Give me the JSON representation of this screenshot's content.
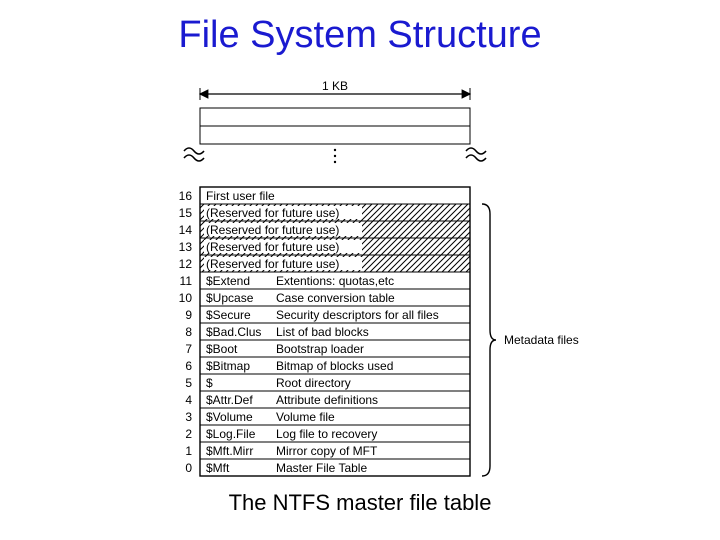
{
  "title": "File System Structure",
  "caption": "The NTFS master file table",
  "size_label": "1 KB",
  "brace_label": "Metadata files",
  "chart_data": {
    "type": "table",
    "title": "NTFS Master File Table layout",
    "rows": [
      {
        "index": 0,
        "name": "$Mft",
        "desc": "Master File Table",
        "hatched": false
      },
      {
        "index": 1,
        "name": "$Mft.Mirr",
        "desc": "Mirror copy of MFT",
        "hatched": false
      },
      {
        "index": 2,
        "name": "$Log.File",
        "desc": "Log file to recovery",
        "hatched": false
      },
      {
        "index": 3,
        "name": "$Volume",
        "desc": "Volume file",
        "hatched": false
      },
      {
        "index": 4,
        "name": "$Attr.Def",
        "desc": "Attribute definitions",
        "hatched": false
      },
      {
        "index": 5,
        "name": "$",
        "desc": "Root directory",
        "hatched": false
      },
      {
        "index": 6,
        "name": "$Bitmap",
        "desc": "Bitmap of blocks used",
        "hatched": false
      },
      {
        "index": 7,
        "name": "$Boot",
        "desc": "Bootstrap loader",
        "hatched": false
      },
      {
        "index": 8,
        "name": "$Bad.Clus",
        "desc": "List of bad blocks",
        "hatched": false
      },
      {
        "index": 9,
        "name": "$Secure",
        "desc": "Security descriptors for all files",
        "hatched": false
      },
      {
        "index": 10,
        "name": "$Upcase",
        "desc": "Case conversion table",
        "hatched": false
      },
      {
        "index": 11,
        "name": "$Extend",
        "desc": "Extentions: quotas,etc",
        "hatched": false
      },
      {
        "index": 12,
        "name": "",
        "desc": "(Reserved for future use)",
        "hatched": true
      },
      {
        "index": 13,
        "name": "",
        "desc": "(Reserved for future use)",
        "hatched": true
      },
      {
        "index": 14,
        "name": "",
        "desc": "(Reserved for future use)",
        "hatched": true
      },
      {
        "index": 15,
        "name": "",
        "desc": "(Reserved for future use)",
        "hatched": true
      },
      {
        "index": 16,
        "name": "",
        "desc": "First user file",
        "hatched": false
      }
    ]
  }
}
